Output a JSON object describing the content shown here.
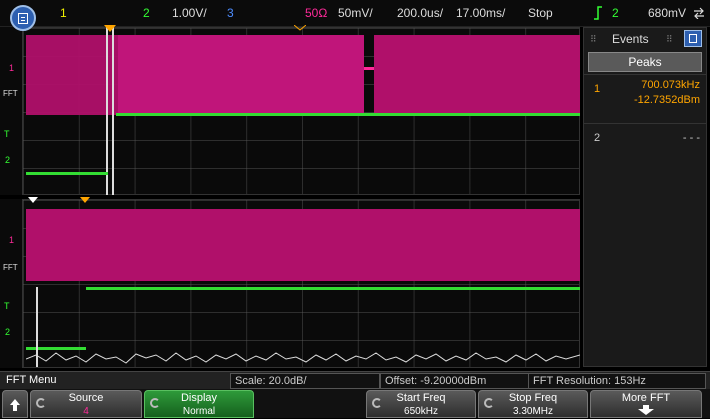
{
  "top_bar": {
    "ch1_label": "1",
    "ch2_label": "2",
    "ch1_scale": "1.00V/",
    "ch3_label": "3",
    "impedance": "50Ω",
    "ch3_scale": "50mV/",
    "timebase": "200.0us/",
    "delay": "17.00ms/",
    "run_state": "Stop",
    "trigger_source": "2",
    "trigger_level": "680mV",
    "colors": {
      "ch1": "#f0f000",
      "ch2": "#33ff33",
      "ch3": "#4d8cff",
      "math": "#ff2a9a",
      "trigger": "#ffa500"
    }
  },
  "waveform_labels": {
    "fft_tag": "FFT",
    "ch1_tag": "1",
    "ch2_tag": "2",
    "trigger_tag": "T"
  },
  "events_panel": {
    "title": "Events",
    "peaks_label": "Peaks",
    "rows": [
      {
        "index": "1",
        "freq": "700.073kHz",
        "level": "-12.7352dBm"
      },
      {
        "index": "2",
        "freq": "- - -",
        "level": ""
      }
    ]
  },
  "status_bar": {
    "menu": "FFT Menu",
    "scale": "Scale: 20.0dB/",
    "offset": "Offset: -9.20000dBm",
    "resolution": "FFT Resolution: 153Hz"
  },
  "softkeys": {
    "source_label": "Source",
    "source_value": "4",
    "display_label": "Display",
    "display_value": "Normal",
    "start_label": "Start Freq",
    "start_value": "650kHz",
    "stop_label": "Stop Freq",
    "stop_value": "3.30MHz",
    "more_label": "More FFT"
  }
}
